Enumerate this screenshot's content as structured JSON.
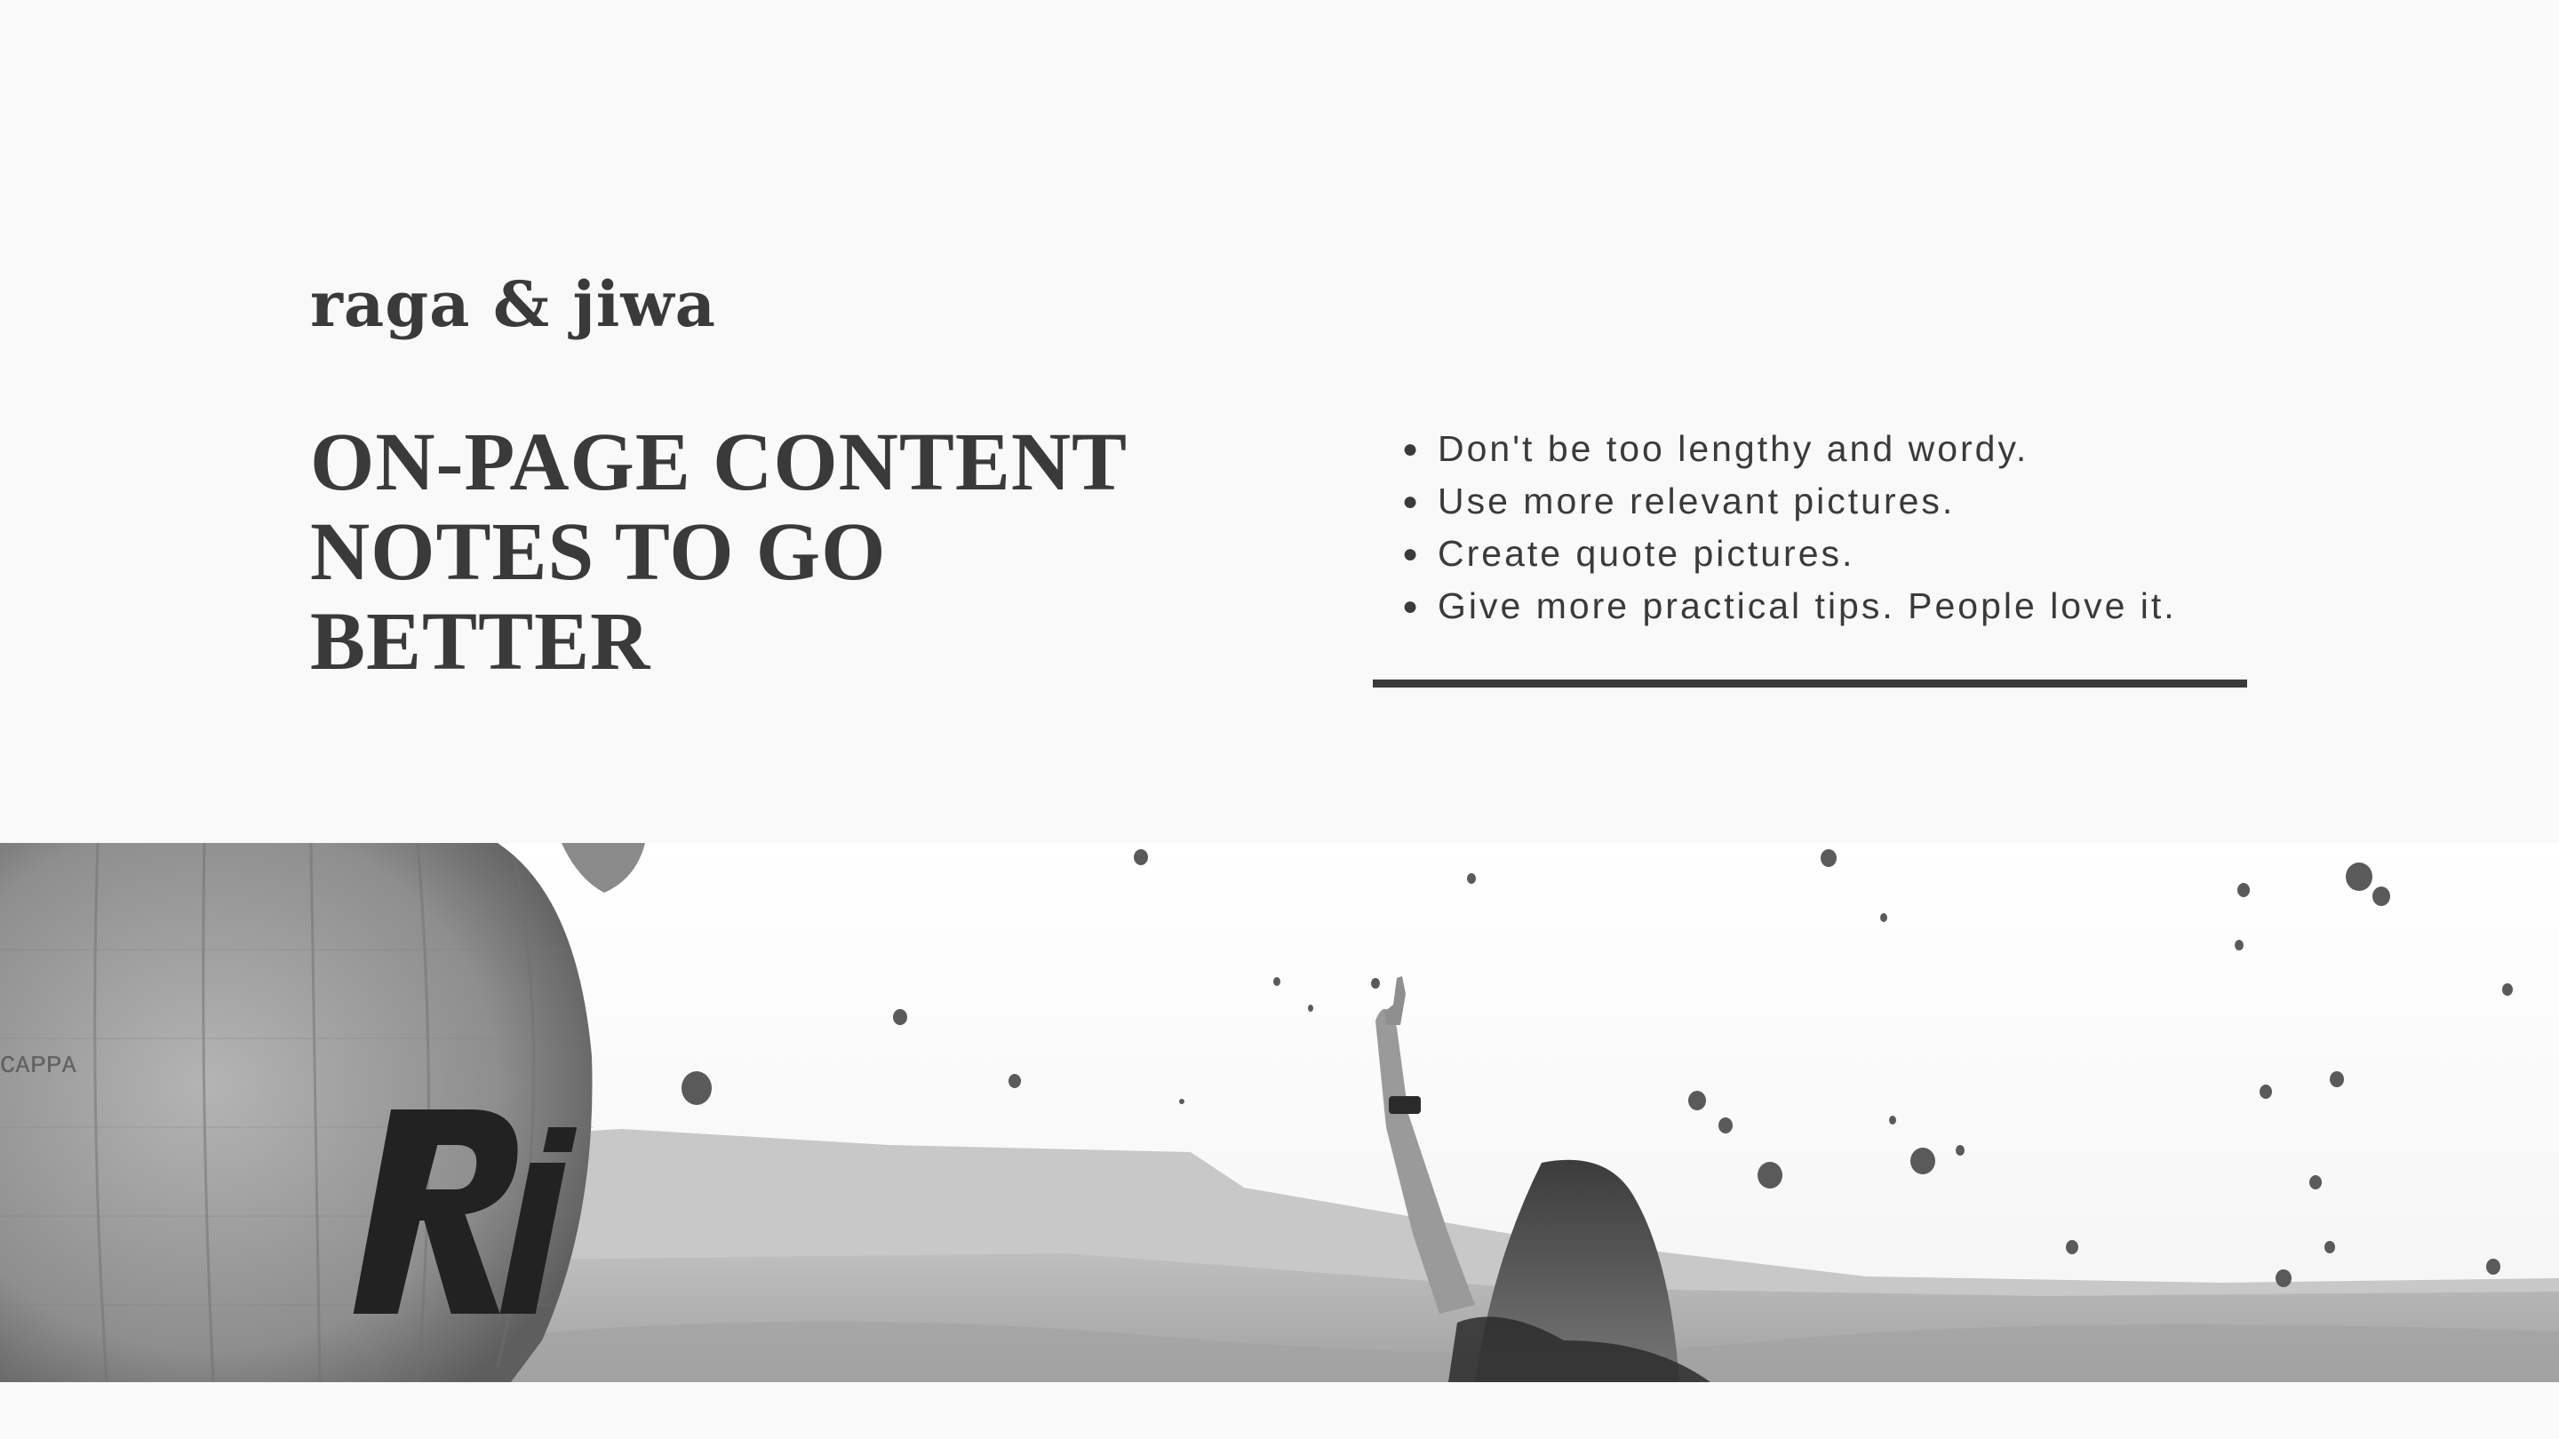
{
  "brand": "raga & jiwa",
  "title_lines": [
    "ON-PAGE CONTENT",
    "NOTES TO GO",
    "BETTER"
  ],
  "tips": [
    "Don't be too lengthy and wordy.",
    "Use more relevant pictures.",
    "Create quote pictures.",
    "Give more practical tips. People love it."
  ],
  "colors": {
    "background": "#f9f9f9",
    "text": "#3a3a3a",
    "accent_rule": "#3a3a3a"
  },
  "photo": {
    "style": "grayscale",
    "balloon_lettering": "Ri"
  }
}
